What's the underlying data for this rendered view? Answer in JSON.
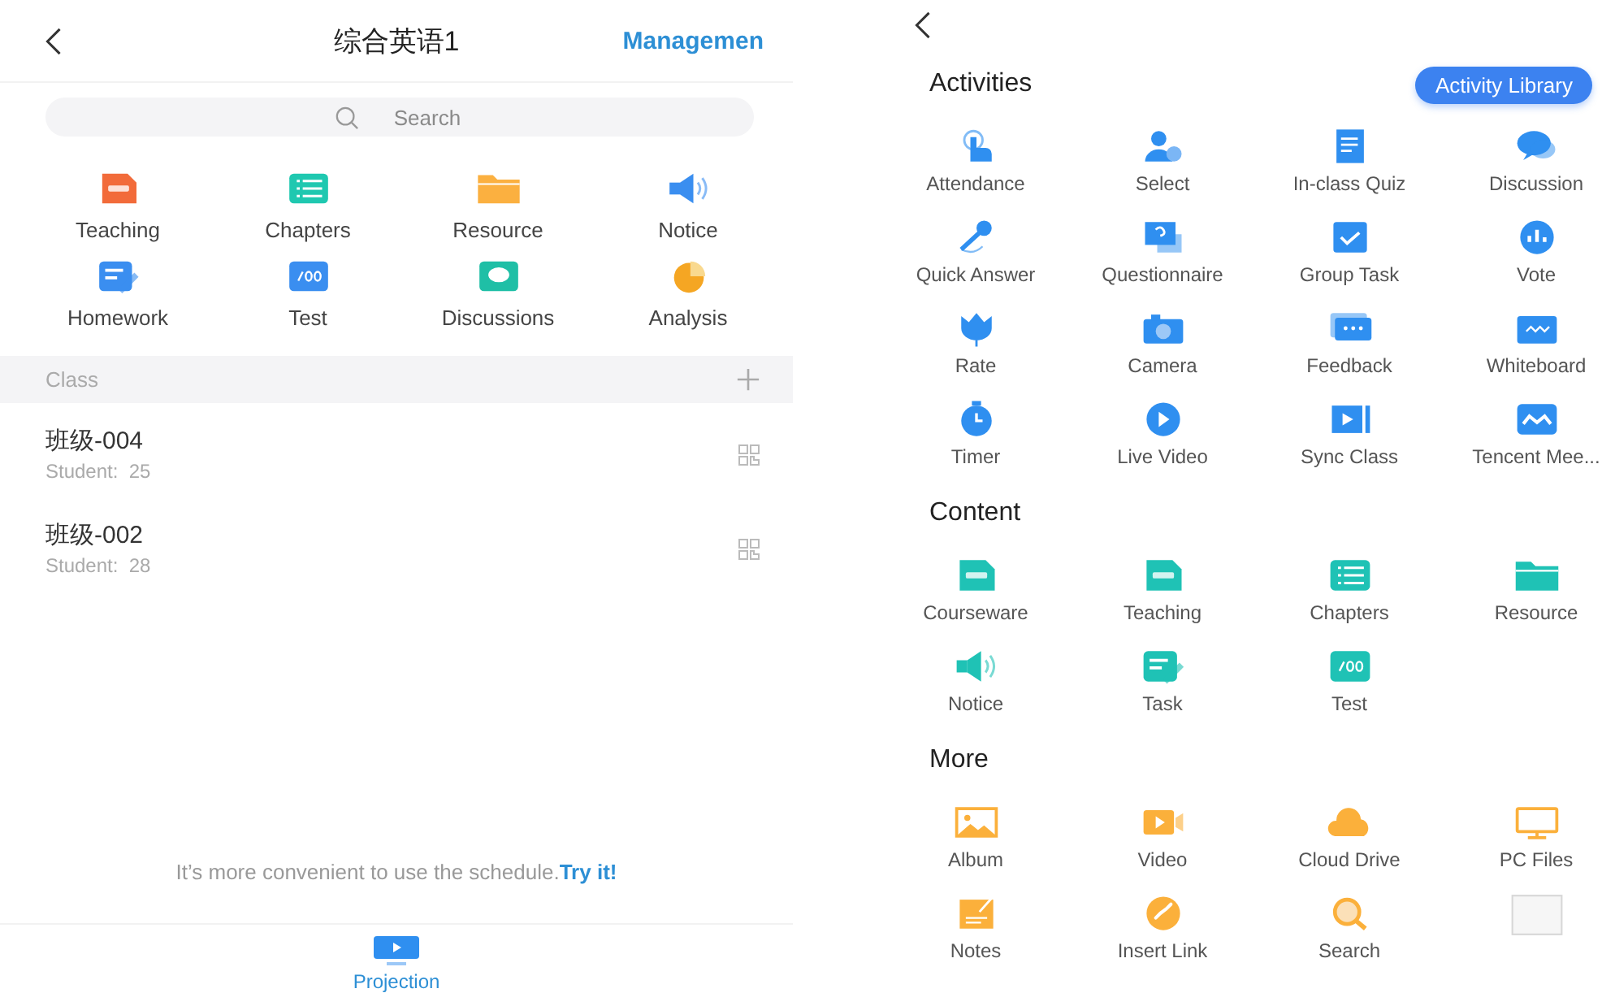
{
  "course_screen": {
    "title": "综合英语1",
    "management": "Managemen",
    "search": {
      "placeholder": "Search"
    },
    "tools": [
      {
        "label": "Teaching"
      },
      {
        "label": "Chapters"
      },
      {
        "label": "Resource"
      },
      {
        "label": "Notice"
      },
      {
        "label": "Homework"
      },
      {
        "label": "Test"
      },
      {
        "label": "Discussions"
      },
      {
        "label": "Analysis"
      }
    ],
    "class_header": "Class",
    "classes": [
      {
        "name": "班级-004",
        "students": "Student:  25"
      },
      {
        "name": "班级-002",
        "students": "Student:  28"
      }
    ],
    "hint": {
      "text": "It’s more convenient to use the schedule.",
      "link": "Try it!"
    },
    "bottom_tab": "Projection"
  },
  "tools_screen": {
    "sections": [
      {
        "title": "Activities",
        "action": "Activity Library",
        "items": [
          {
            "kind": "tool",
            "label": "Attendance"
          },
          {
            "kind": "tool",
            "label": "Select"
          },
          {
            "kind": "tool",
            "label": "In-class Quiz"
          },
          {
            "kind": "tool",
            "label": "Discussion"
          },
          {
            "kind": "tool",
            "label": "Quick Answer"
          },
          {
            "kind": "tool",
            "label": "Questionnaire"
          },
          {
            "kind": "tool",
            "label": "Group Task"
          },
          {
            "kind": "tool",
            "label": "Vote"
          },
          {
            "kind": "tool",
            "label": "Rate"
          },
          {
            "kind": "tool",
            "label": "Camera"
          },
          {
            "kind": "tool",
            "label": "Feedback"
          },
          {
            "kind": "tool",
            "label": "Whiteboard"
          },
          {
            "kind": "tool",
            "label": "Timer"
          },
          {
            "kind": "tool",
            "label": "Live Video"
          },
          {
            "kind": "tool",
            "label": "Sync Class"
          },
          {
            "kind": "tool",
            "label": "Tencent Mee..."
          }
        ]
      },
      {
        "title": "Content",
        "items": [
          {
            "kind": "tool",
            "label": "Courseware"
          },
          {
            "kind": "tool",
            "label": "Teaching"
          },
          {
            "kind": "tool",
            "label": "Chapters"
          },
          {
            "kind": "tool",
            "label": "Resource"
          },
          {
            "kind": "tool",
            "label": "Notice"
          },
          {
            "kind": "tool",
            "label": "Task"
          },
          {
            "kind": "tool",
            "label": "Test"
          }
        ]
      },
      {
        "title": "More",
        "items": [
          {
            "kind": "tool",
            "label": "Album"
          },
          {
            "kind": "tool",
            "label": "Video"
          },
          {
            "kind": "tool",
            "label": "Cloud Drive"
          },
          {
            "kind": "tool",
            "label": "PC Files"
          },
          {
            "kind": "tool",
            "label": "Notes"
          },
          {
            "kind": "tool",
            "label": "Insert Link"
          },
          {
            "kind": "tool",
            "label": "Search"
          },
          {
            "kind": "blank"
          }
        ]
      }
    ]
  }
}
